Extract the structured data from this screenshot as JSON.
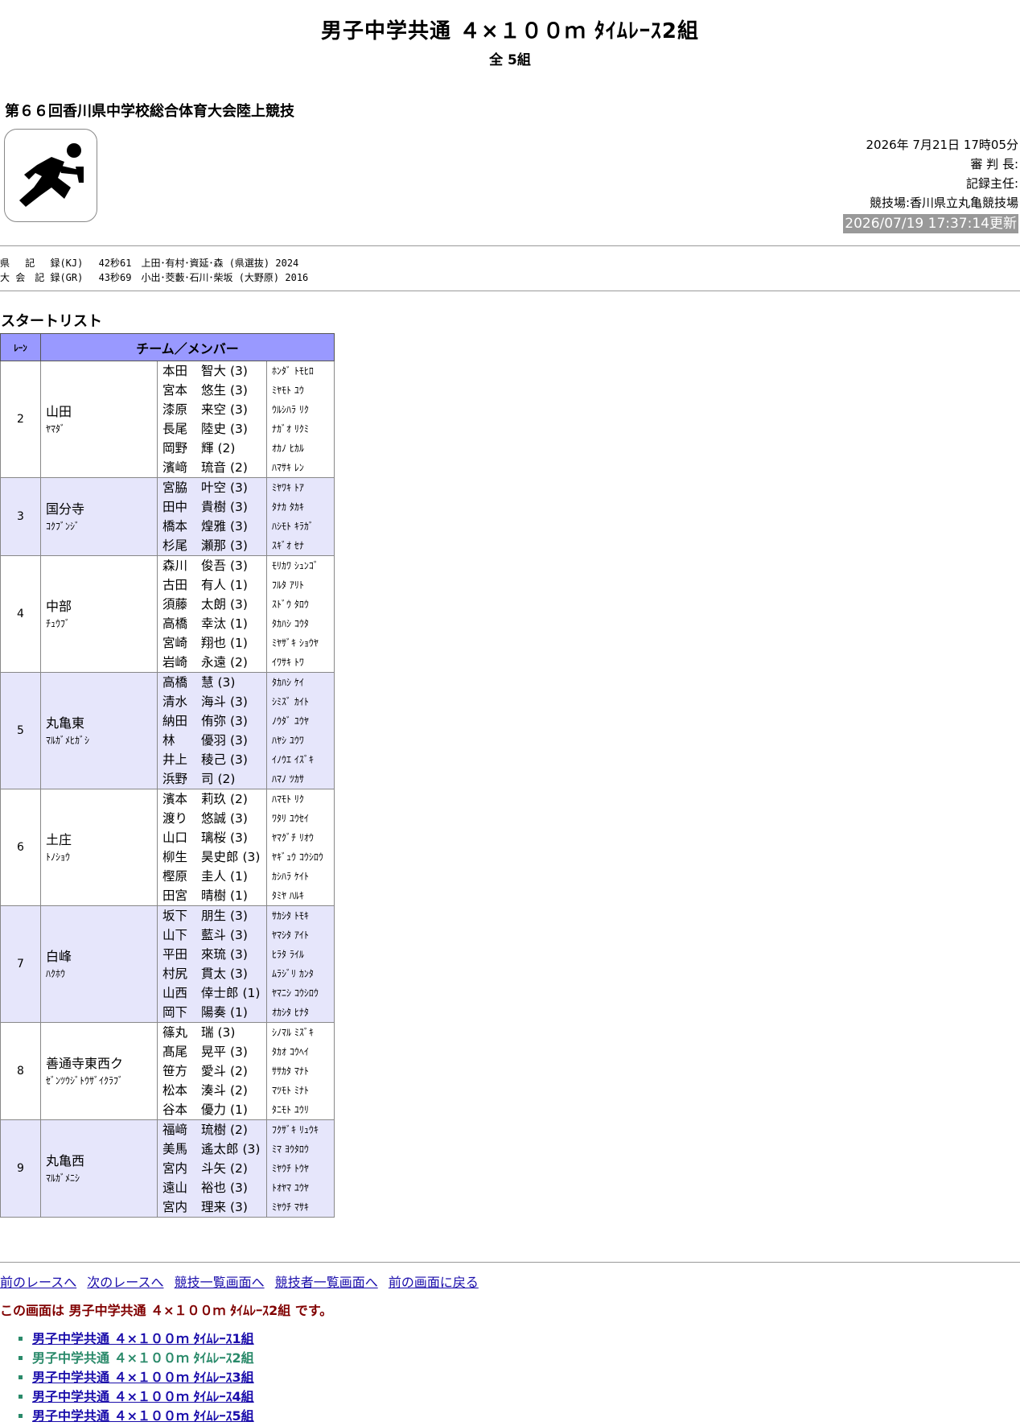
{
  "header": {
    "title": "男子中学共通 ４×１００ｍ ﾀｲﾑﾚｰｽ2組",
    "subtitle": "全 5組",
    "meet_name": "第６６回香川県中学校総合体育大会陸上競技"
  },
  "info": {
    "datetime": "2026年 7月21日 17時05分",
    "referee": "審 判 長:",
    "recorder": "記録主任:",
    "stadium": "競技場:香川県立丸亀競技場",
    "updated": "2026/07/19 17:37:14更新"
  },
  "records": [
    "県　 記　 録(KJ)　 42秒61　上田･有村･資延･森 (県選抜) 2024",
    "大 会　記 録(GR)　 43秒69　小出･茭藪･石川･柴坂 (大野原) 2016"
  ],
  "startlist_heading": "スタートリスト",
  "table": {
    "col_lane": "ﾚｰﾝ",
    "col_team": "チーム／メンバー",
    "rows": [
      {
        "lane": "2",
        "team": "山田",
        "team_kana": "ﾔﾏﾀﾞ",
        "members": [
          {
            "last": "本田",
            "first": "智大",
            "grade": "(3)",
            "kana": "ﾎﾝﾀﾞ ﾄﾓﾋﾛ"
          },
          {
            "last": "宮本",
            "first": "悠生",
            "grade": "(3)",
            "kana": "ﾐﾔﾓﾄ ﾕｳ"
          },
          {
            "last": "漆原",
            "first": "来空",
            "grade": "(3)",
            "kana": "ｳﾙｼﾊﾗ ﾘｸ"
          },
          {
            "last": "長尾",
            "first": "陸史",
            "grade": "(3)",
            "kana": "ﾅｶﾞｵ ﾘｸﾐ"
          },
          {
            "last": "岡野",
            "first": "輝",
            "grade": "(2)",
            "kana": "ｵｶﾉ ﾋｶﾙ"
          },
          {
            "last": "濱﨑",
            "first": "琉音",
            "grade": "(2)",
            "kana": "ﾊﾏｻｷ ﾚﾝ"
          }
        ]
      },
      {
        "lane": "3",
        "team": "国分寺",
        "team_kana": "ｺｸﾌﾞﾝｼﾞ",
        "members": [
          {
            "last": "宮脇",
            "first": "叶空",
            "grade": "(3)",
            "kana": "ﾐﾔﾜｷ ﾄｱ"
          },
          {
            "last": "田中",
            "first": "貴樹",
            "grade": "(3)",
            "kana": "ﾀﾅｶ ﾀｶｷ"
          },
          {
            "last": "橋本",
            "first": "煌雅",
            "grade": "(3)",
            "kana": "ﾊｼﾓﾄ ｷﾗｶﾞ"
          },
          {
            "last": "杉尾",
            "first": "瀬那",
            "grade": "(3)",
            "kana": "ｽｷﾞｵ ｾﾅ"
          }
        ]
      },
      {
        "lane": "4",
        "team": "中部",
        "team_kana": "ﾁｭｳﾌﾞ",
        "members": [
          {
            "last": "森川",
            "first": "俊吾",
            "grade": "(3)",
            "kana": "ﾓﾘｶﾜ ｼｭﾝｺﾞ"
          },
          {
            "last": "古田",
            "first": "有人",
            "grade": "(1)",
            "kana": "ﾌﾙﾀ ｱﾘﾄ"
          },
          {
            "last": "須藤",
            "first": "太朗",
            "grade": "(3)",
            "kana": "ｽﾄﾞｳ ﾀﾛｳ"
          },
          {
            "last": "高橋",
            "first": "幸汰",
            "grade": "(1)",
            "kana": "ﾀｶﾊｼ ｺｳﾀ"
          },
          {
            "last": "宮崎",
            "first": "翔也",
            "grade": "(1)",
            "kana": "ﾐﾔｻﾞｷ ｼｮｳﾔ"
          },
          {
            "last": "岩崎",
            "first": "永遠",
            "grade": "(2)",
            "kana": "ｲﾜｻｷ ﾄﾜ"
          }
        ]
      },
      {
        "lane": "5",
        "team": "丸亀東",
        "team_kana": "ﾏﾙｶﾞﾒﾋｶﾞｼ",
        "members": [
          {
            "last": "高橋",
            "first": "慧",
            "grade": "(3)",
            "kana": "ﾀｶﾊｼ ｹｲ"
          },
          {
            "last": "清水",
            "first": "海斗",
            "grade": "(3)",
            "kana": "ｼﾐｽﾞ ｶｲﾄ"
          },
          {
            "last": "納田",
            "first": "侑弥",
            "grade": "(3)",
            "kana": "ﾉｳﾀﾞ ﾕｳﾔ"
          },
          {
            "last": "林",
            "first": "優羽",
            "grade": "(3)",
            "kana": "ﾊﾔｼ ﾕｳﾜ"
          },
          {
            "last": "井上",
            "first": "稜己",
            "grade": "(3)",
            "kana": "ｲﾉｳｴ ｲｽﾞｷ"
          },
          {
            "last": "浜野",
            "first": "司",
            "grade": "(2)",
            "kana": "ﾊﾏﾉ ﾂｶｻ"
          }
        ]
      },
      {
        "lane": "6",
        "team": "土庄",
        "team_kana": "ﾄﾉｼｮｳ",
        "members": [
          {
            "last": "濱本",
            "first": "莉玖",
            "grade": "(2)",
            "kana": "ﾊﾏﾓﾄ ﾘｸ"
          },
          {
            "last": "渡り",
            "first": "悠誠",
            "grade": "(3)",
            "kana": "ﾜﾀﾘ ﾕｳｾｲ"
          },
          {
            "last": "山口",
            "first": "璃桜",
            "grade": "(3)",
            "kana": "ﾔﾏｸﾞﾁ ﾘｵｳ"
          },
          {
            "last": "柳生",
            "first": "昊史郎",
            "grade": "(3)",
            "kana": "ﾔｷﾞｭｳ ｺｳｼﾛｳ"
          },
          {
            "last": "樫原",
            "first": "圭人",
            "grade": "(1)",
            "kana": "ｶｼﾊﾗ ｹｲﾄ"
          },
          {
            "last": "田宮",
            "first": "晴樹",
            "grade": "(1)",
            "kana": "ﾀﾐﾔ ﾊﾙｷ"
          }
        ]
      },
      {
        "lane": "7",
        "team": "白峰",
        "team_kana": "ﾊｸﾎｳ",
        "members": [
          {
            "last": "坂下",
            "first": "朋生",
            "grade": "(3)",
            "kana": "ｻｶｼﾀ ﾄﾓｷ"
          },
          {
            "last": "山下",
            "first": "藍斗",
            "grade": "(3)",
            "kana": "ﾔﾏｼﾀ ｱｲﾄ"
          },
          {
            "last": "平田",
            "first": "來琉",
            "grade": "(3)",
            "kana": "ﾋﾗﾀ ﾗｲﾙ"
          },
          {
            "last": "村尻",
            "first": "貫太",
            "grade": "(3)",
            "kana": "ﾑﾗｼﾞﾘ ｶﾝﾀ"
          },
          {
            "last": "山西",
            "first": "倖士郎",
            "grade": "(1)",
            "kana": "ﾔﾏﾆｼ ｺｳｼﾛｳ"
          },
          {
            "last": "岡下",
            "first": "陽奏",
            "grade": "(1)",
            "kana": "ｵｶｼﾀ ﾋﾅﾀ"
          }
        ]
      },
      {
        "lane": "8",
        "team": "善通寺東西ク",
        "team_kana": "ｾﾞﾝﾂｳｼﾞﾄｳｻﾞｲｸﾗﾌﾞ",
        "members": [
          {
            "last": "篠丸",
            "first": "瑞",
            "grade": "(3)",
            "kana": "ｼﾉﾏﾙ ﾐｽﾞｷ"
          },
          {
            "last": "髙尾",
            "first": "晃平",
            "grade": "(3)",
            "kana": "ﾀｶｵ ｺｳﾍｲ"
          },
          {
            "last": "笹方",
            "first": "愛斗",
            "grade": "(2)",
            "kana": "ｻｻｶﾀ ﾏﾅﾄ"
          },
          {
            "last": "松本",
            "first": "湊斗",
            "grade": "(2)",
            "kana": "ﾏﾂﾓﾄ ﾐﾅﾄ"
          },
          {
            "last": "谷本",
            "first": "優力",
            "grade": "(1)",
            "kana": "ﾀﾆﾓﾄ ﾕｳﾘ"
          }
        ]
      },
      {
        "lane": "9",
        "team": "丸亀西",
        "team_kana": "ﾏﾙｶﾞﾒﾆｼ",
        "members": [
          {
            "last": "福﨑",
            "first": "琉樹",
            "grade": "(2)",
            "kana": "ﾌｸｻﾞｷ ﾘｭｳｷ"
          },
          {
            "last": "美馬",
            "first": "遙太郎",
            "grade": "(3)",
            "kana": "ﾐﾏ ﾖｳﾀﾛｳ"
          },
          {
            "last": "宮内",
            "first": "斗矢",
            "grade": "(2)",
            "kana": "ﾐﾔｳﾁ ﾄｳﾔ"
          },
          {
            "last": "遠山",
            "first": "裕也",
            "grade": "(3)",
            "kana": "ﾄｵﾔﾏ ﾕｳﾔ"
          },
          {
            "last": "宮内",
            "first": "理来",
            "grade": "(3)",
            "kana": "ﾐﾔｳﾁ ﾏｻｷ"
          }
        ]
      }
    ]
  },
  "nav": {
    "prev_race": "前のレースへ",
    "next_race": "次のレースへ",
    "event_list": "競技一覧画面へ",
    "athlete_list": "競技者一覧画面へ",
    "back": "前の画面に戻る"
  },
  "current_note": "この画面は 男子中学共通 ４×１００ｍ ﾀｲﾑﾚｰｽ2組 です。",
  "race_links": [
    "男子中学共通 ４×１００ｍ ﾀｲﾑﾚｰｽ1組",
    "男子中学共通 ４×１００ｍ ﾀｲﾑﾚｰｽ2組",
    "男子中学共通 ４×１００ｍ ﾀｲﾑﾚｰｽ3組",
    "男子中学共通 ４×１００ｍ ﾀｲﾑﾚｰｽ4組",
    "男子中学共通 ４×１００ｍ ﾀｲﾑﾚｰｽ5組"
  ],
  "active_race_index": 1,
  "icons": {
    "logo": "sprinter-icon"
  }
}
